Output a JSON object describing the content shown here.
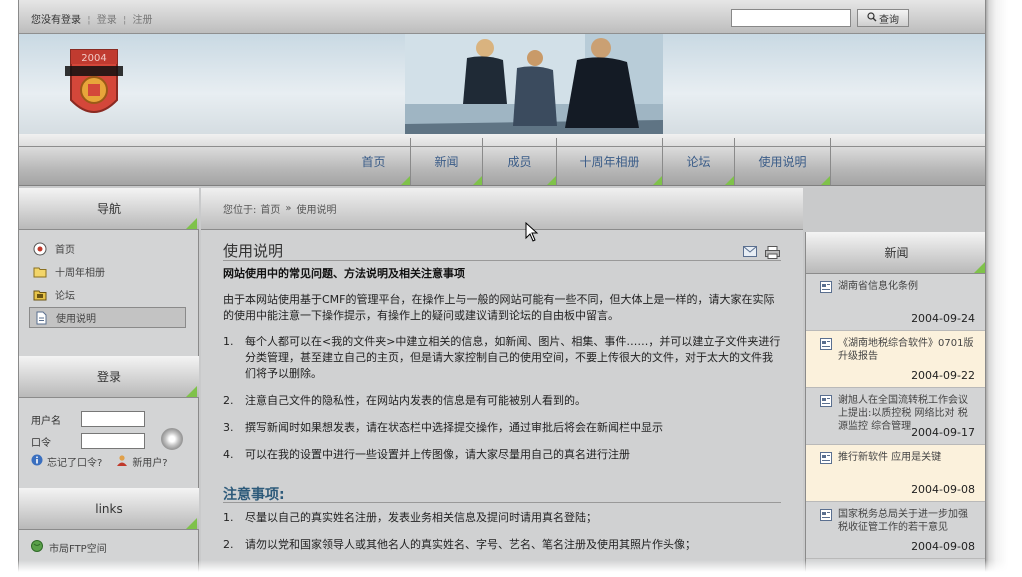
{
  "topbar": {
    "login_status": "您没有登录",
    "login_link": "登录",
    "register_link": "注册",
    "search_placeholder": "",
    "search_button": "查询"
  },
  "banner": {
    "logo_year": "2004"
  },
  "nav": {
    "items": [
      "首页",
      "新闻",
      "成员",
      "十周年相册",
      "论坛",
      "使用说明"
    ]
  },
  "sidebar": {
    "nav_title": "导航",
    "items": [
      {
        "label": "首页",
        "icon": "radio-icon"
      },
      {
        "label": "十周年相册",
        "icon": "folder-icon"
      },
      {
        "label": "论坛",
        "icon": "forum-folder-icon"
      },
      {
        "label": "使用说明",
        "icon": "document-icon"
      }
    ],
    "login_title": "登录",
    "username_label": "用户名",
    "password_label": "口令",
    "forgot_password": "忘记了口令?",
    "new_user": "新用户?",
    "links_title": "links",
    "links": [
      "市局FTP空间"
    ]
  },
  "breadcrumb": {
    "prefix": "您位于:",
    "home": "首页",
    "separator": "»",
    "current": "使用说明"
  },
  "article": {
    "title": "使用说明",
    "subtitle": "网站使用中的常见问题、方法说明及相关注意事项",
    "intro": "由于本网站使用基于CMF的管理平台，在操作上与一般的网站可能有一些不同，但大体上是一样的，请大家在实际的使用中能注意一下操作提示，有操作上的疑问或建议请到论坛的自由板中留言。",
    "rules": [
      "每个人都可以在<我的文件夹>中建立相关的信息，如新闻、图片、相集、事件……，并可以建立子文件夹进行分类管理，甚至建立自己的主页，但是请大家控制自己的使用空间，不要上传很大的文件，对于太大的文件我们将予以删除。",
      "注意自己文件的隐私性，在网站内发表的信息是有可能被别人看到的。",
      "撰写新闻时如果想发表，请在状态栏中选择提交操作，通过审批后将会在新闻栏中显示",
      "可以在我的设置中进行一些设置并上传图像，请大家尽量用自己的真名进行注册"
    ],
    "notice_title": "注意事项:",
    "notices": [
      "尽量以自己的真实姓名注册，发表业务相关信息及提问时请用真名登陆；",
      "请勿以党和国家领导人或其他名人的真实姓名、字号、艺名、笔名注册及使用其照片作头像；"
    ]
  },
  "news": {
    "title": "新闻",
    "items": [
      {
        "title": "湖南省信息化条例",
        "date": "2004-09-24",
        "highlight": false
      },
      {
        "title": "《湖南地税综合软件》0701版升级报告",
        "date": "2004-09-22",
        "highlight": true
      },
      {
        "title": "谢旭人在全国流转税工作会议上提出:以质控税 网络比对 税源监控 综合管理",
        "date": "2004-09-17",
        "highlight": false
      },
      {
        "title": "推行新软件 应用是关键",
        "date": "2004-09-08",
        "highlight": true
      },
      {
        "title": "国家税务总局关于进一步加强税收征管工作的若干意见",
        "date": "2004-09-08",
        "highlight": false
      }
    ]
  },
  "colors": {
    "nav_text": "#3a5c88",
    "accent_green": "#7fc24a",
    "notice_heading": "#2d5a7a",
    "highlight_bg": "#fbf1dc",
    "logo_red": "#d4473a"
  }
}
